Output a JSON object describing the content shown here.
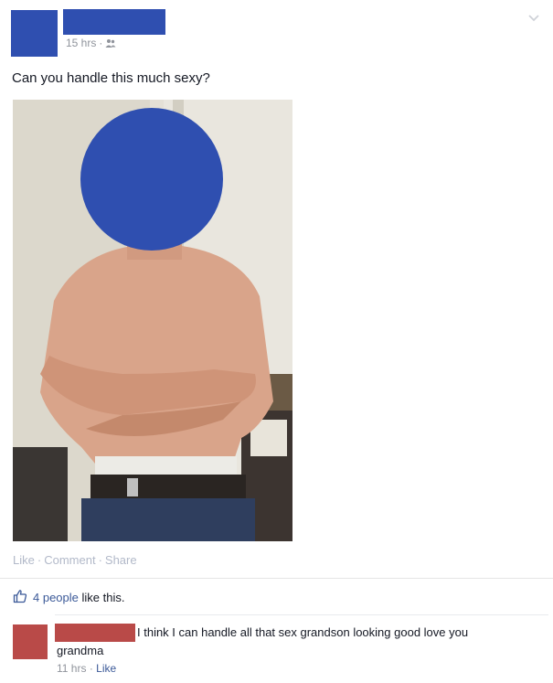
{
  "post": {
    "timestamp": "15 hrs",
    "separator": "·",
    "audience_icon": "friends-icon",
    "status_text": "Can you handle this much sexy?",
    "redaction_color": "#2f4fb0"
  },
  "actions": {
    "like": "Like",
    "comment": "Comment",
    "share": "Share",
    "dot": "·"
  },
  "likes": {
    "count_text": "4 people",
    "suffix": "like this."
  },
  "comment": {
    "text_line1": "I think I can handle all that sex grandson looking good love you",
    "text_line2": "grandma",
    "timestamp": "11 hrs",
    "like": "Like",
    "redaction_color": "#b94a48"
  }
}
